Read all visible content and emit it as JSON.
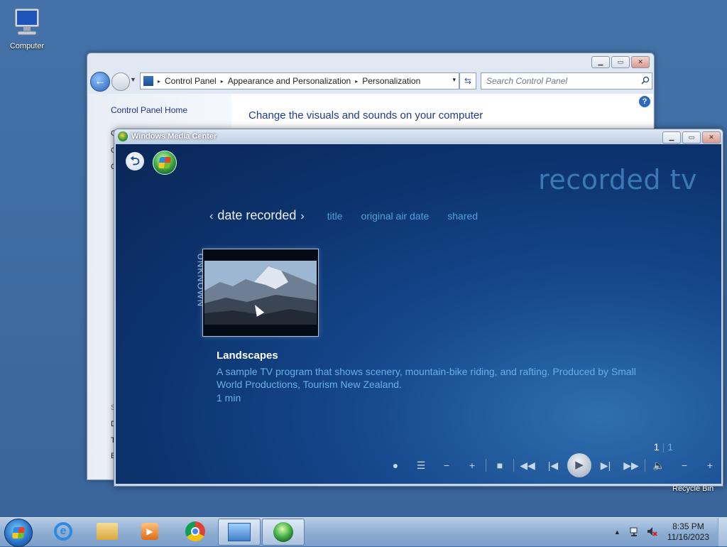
{
  "desktop": {
    "computer_label": "Computer",
    "recycle_label": "Recycle Bin"
  },
  "control_panel": {
    "nav": {
      "back_glyph": "←",
      "dropdown_glyph": "▼",
      "refresh_glyph": "⇆"
    },
    "address": {
      "crumbs": [
        "Control Panel",
        "Appearance and Personalization",
        "Personalization"
      ],
      "separator": "▸",
      "dropdown": "▾"
    },
    "search_placeholder": "Search Control Panel",
    "search_icon": "search-icon",
    "home_link": "Control Panel Home",
    "main_title": "Change the visuals and sounds on your computer",
    "help_glyph": "?",
    "hidden_fragments": [
      "C",
      "C",
      "C",
      "S",
      "D",
      "T",
      "E"
    ]
  },
  "media_center": {
    "window_title": "Windows Media Center",
    "back_glyph": "⮌",
    "section_title": "recorded tv",
    "pivots": {
      "active": "date recorded",
      "prev_glyph": "‹",
      "next_glyph": "›",
      "others": [
        "title",
        "original air date",
        "shared"
      ]
    },
    "group_label": "UNKNOWN",
    "program": {
      "title": "Landscapes",
      "description": "A sample TV program that shows scenery, mountain-bike riding, and rafting. Produced by Small World Productions, Tourism New Zealand.",
      "duration": "1 min"
    },
    "pager": {
      "current": "1",
      "separator": "|",
      "total": "1"
    },
    "transport": {
      "record": "●",
      "guide": "☰",
      "channel_down": "−",
      "channel_up": "+",
      "stop": "■",
      "rewind": "◀◀",
      "skip_back": "|◀",
      "play": "▶",
      "skip_forward": "▶|",
      "fast_forward": "▶▶",
      "mute": "🔈",
      "volume_down": "−",
      "volume_up": "+"
    }
  },
  "window_controls": {
    "minimize": "▁",
    "maximize": "▭",
    "close": "✕"
  },
  "taskbar": {
    "clock_time": "8:35 PM",
    "clock_date": "11/16/2023",
    "tray_up": "▲",
    "ie_glyph": "e",
    "wmp_glyph": "▶"
  },
  "colors": {
    "desktop_bg": "#3e6aa0",
    "mc_bg_dark": "#0a2656",
    "mc_accent_blue": "#4ea2dc",
    "cp_link": "#1e3287"
  }
}
